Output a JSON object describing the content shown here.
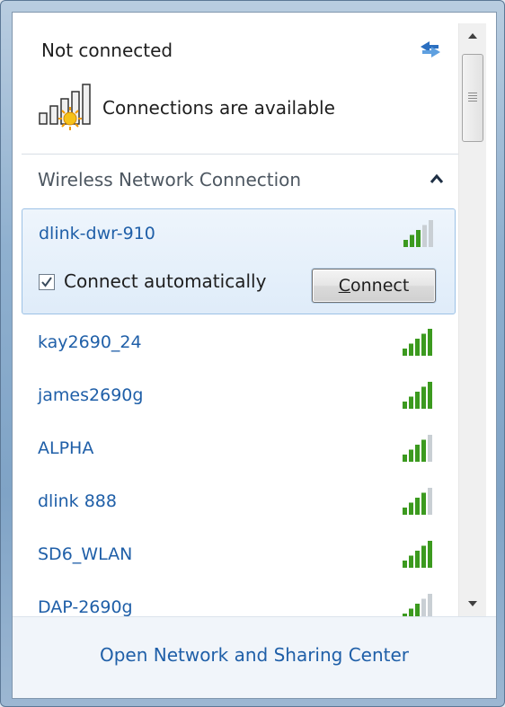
{
  "header": {
    "status": "Not connected",
    "connections_text": "Connections are available"
  },
  "section": {
    "title": "Wireless Network Connection"
  },
  "selected_network": {
    "name": "dlink-dwr-910",
    "signal_bars": 3,
    "connect_automatically_label": "Connect automatically",
    "connect_automatically_checked": true,
    "connect_button_accesskey": "C",
    "connect_button_rest": "onnect"
  },
  "networks": [
    {
      "name": "kay2690_24",
      "signal_bars": 5
    },
    {
      "name": "james2690g",
      "signal_bars": 5
    },
    {
      "name": "ALPHA",
      "signal_bars": 4
    },
    {
      "name": "dlink 888",
      "signal_bars": 4
    },
    {
      "name": "SD6_WLAN",
      "signal_bars": 5
    },
    {
      "name": "DAP-2690g",
      "signal_bars": 3
    }
  ],
  "footer": {
    "link": "Open Network and Sharing Center"
  },
  "colors": {
    "signal_on": "#3c9a1f",
    "signal_off": "#c9cfd4",
    "link": "#1f5fa8"
  },
  "icons": {
    "refresh": "refresh-icon",
    "connections": "network-bars-sunburst-icon",
    "collapse": "chevron-up-icon",
    "signal": "wifi-signal-icon"
  }
}
